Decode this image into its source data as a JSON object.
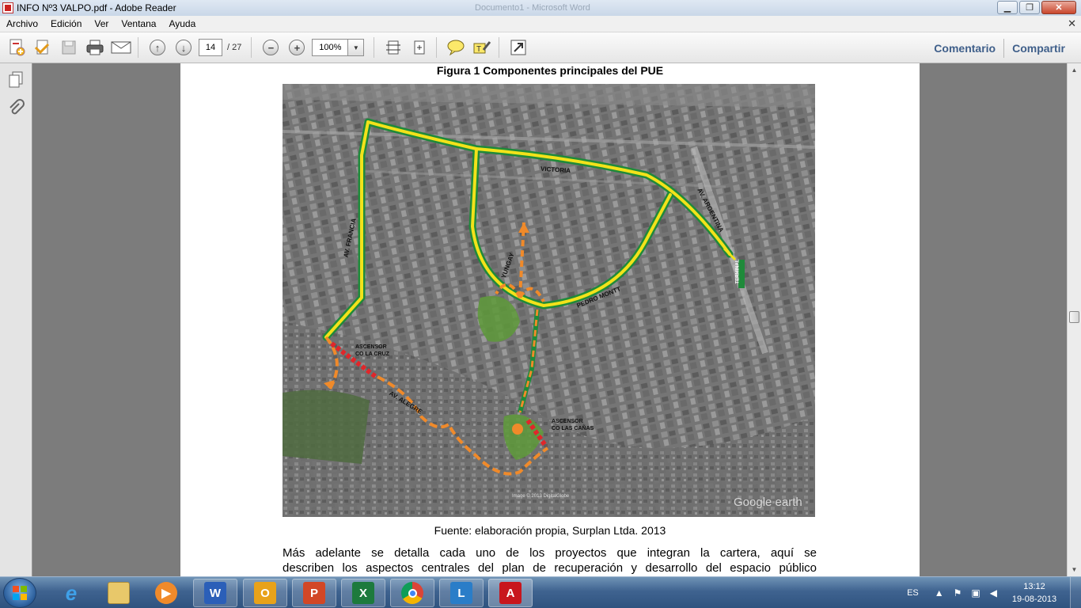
{
  "window": {
    "title": "INFO Nº3 VALPO.pdf - Adobe Reader",
    "background_title": "Documento1 - Microsoft Word"
  },
  "menu": {
    "items": [
      "Archivo",
      "Edición",
      "Ver",
      "Ventana",
      "Ayuda"
    ],
    "close_glyph": "✕"
  },
  "toolbar": {
    "current_page": "14",
    "page_total": "/ 27",
    "zoom": "100%",
    "comment_label": "Comentario",
    "share_label": "Compartir"
  },
  "document": {
    "figure_title": "Figura 1 Componentes principales del PUE",
    "figure_source": "Fuente: elaboración propia, Surplan Ltda. 2013",
    "body_line1": "Más adelante se detalla cada uno de los proyectos que integran la cartera, aquí se",
    "body_line2": "describen los aspectos centrales del plan de recuperación y desarrollo del espacio público",
    "map": {
      "labels": {
        "victoria": "VICTORIA",
        "argentina": "AV. ARGENTINA",
        "francia": "AV. FRANCIA",
        "pedro_montt": "PEDRO MONTT",
        "yungay": "YUNGAY",
        "ascensor_cruz": "ASCENSOR\nCO LA CRUZ",
        "alegre": "AV. ALEGRE",
        "ascensor_canas": "ASCENSOR\nCO LAS CAÑAS",
        "terminal": "TERMINAL",
        "watermark": "Google earth",
        "imagery": "Image © 2013 DigitalGlobe"
      },
      "colors": {
        "yellow_route": "#f2e21a",
        "green_route": "#1f8a3a",
        "orange_route": "#f08a2a",
        "red_ascensor": "#e0262a",
        "green_park": "#5e9a3a"
      }
    }
  },
  "taskbar": {
    "language": "ES",
    "time": "13:12",
    "date": "19-08-2013"
  }
}
